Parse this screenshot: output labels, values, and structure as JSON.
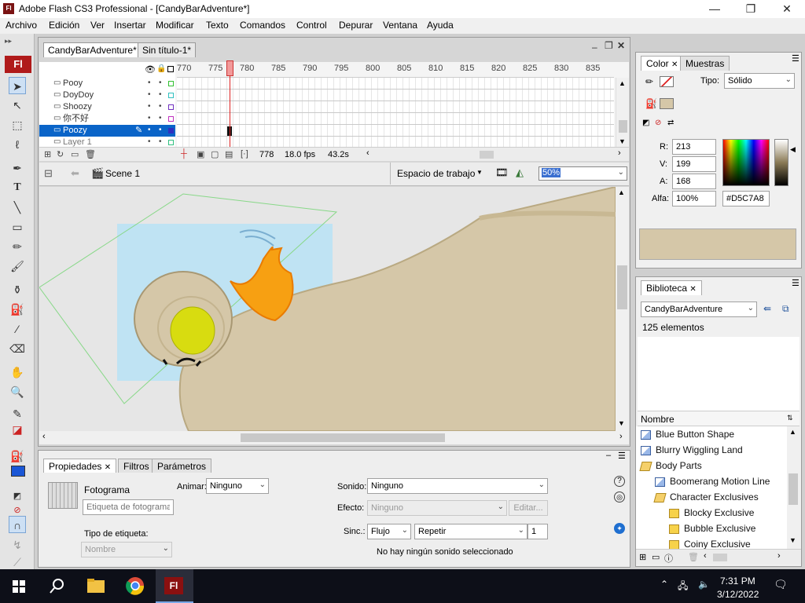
{
  "window": {
    "title": "Adobe Flash CS3 Professional - [CandyBarAdventure*]",
    "app_icon_text": "Fl",
    "minimize": "—",
    "maximize": "❐",
    "close": "✕"
  },
  "menu": [
    "Archivo",
    "Edición",
    "Ver",
    "Insertar",
    "Modificar",
    "Texto",
    "Comandos",
    "Control",
    "Depurar",
    "Ventana",
    "Ayuda"
  ],
  "toolbox": {
    "logo": "Fl"
  },
  "documents": {
    "tabs": [
      "CandyBarAdventure*",
      "Sin título-1*"
    ]
  },
  "timeline": {
    "ruler": [
      "770",
      "775",
      "780",
      "785",
      "790",
      "795",
      "800",
      "805",
      "810",
      "815",
      "820",
      "825",
      "830",
      "835"
    ],
    "layers": [
      "Pooy",
      "DoyDoy",
      "Shoozy",
      "你不好",
      "Poozy",
      "Layer 1"
    ],
    "layer_colors": [
      "#30c030",
      "#30c0c0",
      "#7030c0",
      "#c030c0",
      "#3030c0",
      "#30c080"
    ],
    "selected_layer": "Poozy",
    "current_frame": "778",
    "fps": "18.0 fps",
    "time": "43.2s"
  },
  "editbar": {
    "scene": "Scene 1",
    "workspace": "Espacio de trabajo",
    "zoom": "50%"
  },
  "properties": {
    "tabs": [
      "Propiedades",
      "Filtros",
      "Parámetros"
    ],
    "frame_label": "Fotograma",
    "frame_placeholder": "Etiqueta de fotograma",
    "animate_label": "Animar:",
    "animate_value": "Ninguno",
    "label_type_label": "Tipo de etiqueta:",
    "label_type_value": "Nombre",
    "sound_label": "Sonido:",
    "sound_value": "Ninguno",
    "effect_label": "Efecto:",
    "effect_value": "Ninguno",
    "edit_button": "Editar...",
    "sync_label": "Sinc.:",
    "sync_value": "Flujo",
    "repeat_value": "Repetir",
    "repeat_count": "1",
    "no_sound_msg": "No hay ningún sonido seleccionado"
  },
  "color": {
    "tabs": [
      "Color",
      "Muestras"
    ],
    "type_label": "Tipo:",
    "type_value": "Sólido",
    "r_label": "R:",
    "r": "213",
    "v_label": "V:",
    "v": "199",
    "a_label": "A:",
    "a": "168",
    "alpha_label": "Alfa:",
    "alpha": "100%",
    "hex": "#D5C7A8",
    "swatch_color": "#D5C7A8"
  },
  "library": {
    "tab": "Biblioteca",
    "document": "CandyBarAdventure",
    "count": "125 elementos",
    "column": "Nombre",
    "items": [
      {
        "label": "Blue Button Shape",
        "type": "symbol",
        "level": 0
      },
      {
        "label": "Blurry Wiggling Land",
        "type": "symbol",
        "level": 0
      },
      {
        "label": "Body Parts",
        "type": "folder-open",
        "level": 0
      },
      {
        "label": "Boomerang Motion Line",
        "type": "symbol",
        "level": 1
      },
      {
        "label": "Character Exclusives",
        "type": "folder-open",
        "level": 1
      },
      {
        "label": "Blocky Exclusive",
        "type": "folder",
        "level": 2
      },
      {
        "label": "Bubble Exclusive",
        "type": "folder",
        "level": 2
      },
      {
        "label": "Coiny Exclusive",
        "type": "folder",
        "level": 2
      }
    ]
  },
  "taskbar": {
    "time": "7:31 PM",
    "date": "3/12/2022"
  }
}
